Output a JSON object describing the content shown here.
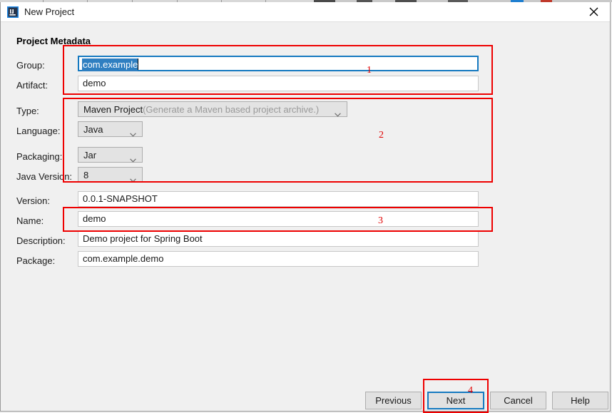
{
  "window": {
    "title": "New Project",
    "icon": "intellij-idea-icon",
    "close_label": "✕"
  },
  "section": {
    "heading": "Project Metadata"
  },
  "fields": [
    {
      "key": "group",
      "label": "Group:",
      "value": "com.example",
      "type": "text",
      "state": "focused-selected"
    },
    {
      "key": "artifact",
      "label": "Artifact:",
      "value": "demo",
      "type": "text",
      "state": "normal"
    },
    {
      "key": "type",
      "label": "Type:",
      "value": "Maven Project",
      "hint": "(Generate a Maven based project archive.)",
      "type": "combo",
      "state": "normal"
    },
    {
      "key": "language",
      "label": "Language:",
      "value": "Java",
      "type": "combo",
      "state": "normal"
    },
    {
      "key": "packaging",
      "label": "Packaging:",
      "value": "Jar",
      "type": "combo",
      "state": "normal"
    },
    {
      "key": "java_version",
      "label": "Java Version:",
      "value": "8",
      "type": "combo",
      "state": "normal"
    },
    {
      "key": "version",
      "label": "Version:",
      "value": "0.0.1-SNAPSHOT",
      "type": "text",
      "state": "normal"
    },
    {
      "key": "name",
      "label": "Name:",
      "value": "demo",
      "type": "text",
      "state": "normal"
    },
    {
      "key": "description",
      "label": "Description:",
      "value": "Demo project for Spring Boot",
      "type": "text",
      "state": "normal"
    },
    {
      "key": "package",
      "label": "Package:",
      "value": "com.example.demo",
      "type": "text",
      "state": "normal"
    }
  ],
  "buttons": {
    "previous": "Previous",
    "next": "Next",
    "cancel": "Cancel",
    "help": "Help",
    "default": "next"
  },
  "annotations": [
    {
      "id": "1",
      "number": "1",
      "target": "group-artifact-group"
    },
    {
      "id": "2",
      "number": "2",
      "target": "type-language-packaging-javaversion-group"
    },
    {
      "id": "3",
      "number": "3",
      "target": "name-field"
    },
    {
      "id": "4",
      "number": "4",
      "target": "next-button"
    }
  ],
  "colors": {
    "annotation": "#ee0000",
    "focus": "#1579c0",
    "selection": "#2f7fc1",
    "dialog_bg": "#f0f0f0",
    "titlebar_bg": "#ffffff",
    "input_bg": "#ffffff",
    "combo_bg": "#e3e3e3"
  }
}
